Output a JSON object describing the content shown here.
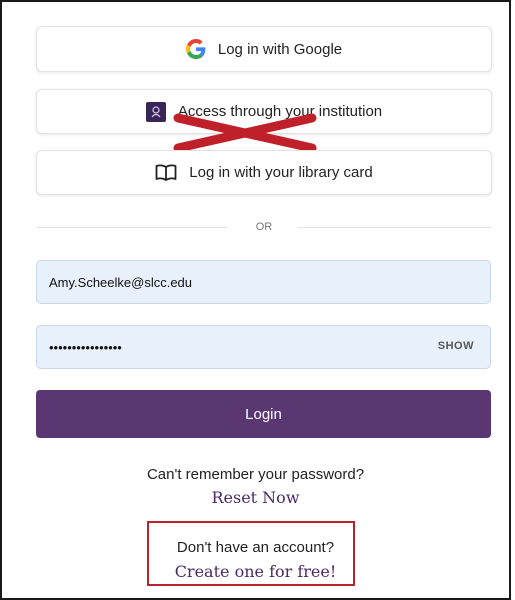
{
  "sso": {
    "google_label": "Log in with Google",
    "institution_label": "Access through your institution",
    "library_label": "Log in with your library card"
  },
  "divider": {
    "label": "OR"
  },
  "form": {
    "email_value": "Amy.Scheelke@slcc.edu",
    "password_value": "••••••••••••••••",
    "show_label": "SHOW",
    "login_label": "Login"
  },
  "recovery": {
    "prompt": "Can't remember your password?",
    "link": "Reset Now"
  },
  "signup": {
    "prompt": "Don't have an account?",
    "link": "Create one for free!"
  },
  "icons": {
    "google": "google-icon",
    "institution": "institution-icon",
    "library": "book-icon",
    "annotation": "red-x-mark"
  },
  "colors": {
    "primary": "#5a3673",
    "link": "#4b2a66",
    "field_bg": "#e8f0fb",
    "annotation_red": "#c0202a"
  }
}
